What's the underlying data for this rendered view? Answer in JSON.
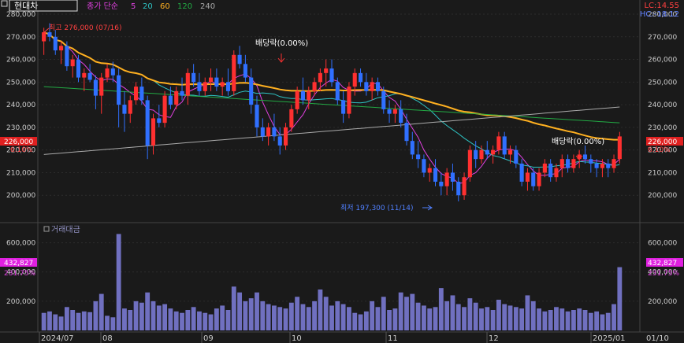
{
  "header": {
    "stock_name": "현대차",
    "ma_label": "종가 단순",
    "ma_periods": [
      "5",
      "20",
      "60",
      "120",
      "240"
    ],
    "ma_colors": [
      "#e040e0",
      "#2ec4c4",
      "#ffb020",
      "#22aa44",
      "#aaaaaa"
    ]
  },
  "top_right": {
    "lc": "LC:14.55",
    "hc": "HC:-18.12"
  },
  "annotations": {
    "high": "최고 276,000 (07/16)",
    "low": "최저 197,300 (11/14)",
    "dividend1": "배당락(0.00%)",
    "dividend2": "배당락(0.00%)"
  },
  "price_axis": {
    "ticks": [
      "280,000",
      "270,000",
      "260,000",
      "250,000",
      "240,000",
      "230,000",
      "220,000",
      "210,000",
      "200,000"
    ],
    "current_price": "226,000",
    "current_pct": "6.10%"
  },
  "volume_panel": {
    "title": "거래대금",
    "ticks": [
      "600,000",
      "400,000",
      "200,000"
    ],
    "current_value": "432,827",
    "current_pct": "231.75%"
  },
  "date_axis": {
    "labels": [
      "2024/07",
      "08",
      "09",
      "10",
      "11",
      "12",
      "2025/01",
      "01/10"
    ]
  },
  "colors": {
    "up": "#ff3030",
    "down": "#3070ff",
    "volume": "#7070c0",
    "bg": "#1a1a1a"
  },
  "chart_data": {
    "type": "candlestick",
    "price_range": [
      195000,
      283000
    ],
    "volume_range": [
      0,
      700000
    ],
    "candles": [
      [
        268000,
        274000,
        262000,
        272000,
        120000
      ],
      [
        272000,
        276000,
        268000,
        270000,
        130000
      ],
      [
        270000,
        273000,
        262000,
        264000,
        110000
      ],
      [
        264000,
        268000,
        258000,
        266000,
        95000
      ],
      [
        266000,
        268000,
        255000,
        257000,
        160000
      ],
      [
        257000,
        262000,
        252000,
        260000,
        140000
      ],
      [
        260000,
        262000,
        250000,
        252000,
        120000
      ],
      [
        252000,
        256000,
        246000,
        254000,
        130000
      ],
      [
        254000,
        258000,
        250000,
        251000,
        125000
      ],
      [
        251000,
        253000,
        238000,
        244000,
        200000
      ],
      [
        244000,
        254000,
        236000,
        252000,
        250000
      ],
      [
        252000,
        258000,
        250000,
        256000,
        100000
      ],
      [
        256000,
        259000,
        250000,
        253000,
        90000
      ],
      [
        253000,
        256000,
        230000,
        240000,
        660000
      ],
      [
        240000,
        246000,
        228000,
        236000,
        150000
      ],
      [
        236000,
        244000,
        232000,
        242000,
        140000
      ],
      [
        242000,
        250000,
        240000,
        248000,
        200000
      ],
      [
        248000,
        252000,
        240000,
        242000,
        190000
      ],
      [
        242000,
        244000,
        216000,
        222000,
        260000
      ],
      [
        222000,
        236000,
        218000,
        234000,
        200000
      ],
      [
        234000,
        240000,
        230000,
        232000,
        170000
      ],
      [
        232000,
        246000,
        230000,
        244000,
        180000
      ],
      [
        244000,
        248000,
        238000,
        240000,
        150000
      ],
      [
        240000,
        248000,
        238000,
        246000,
        130000
      ],
      [
        246000,
        252000,
        242000,
        244000,
        120000
      ],
      [
        244000,
        256000,
        240000,
        254000,
        140000
      ],
      [
        254000,
        258000,
        248000,
        250000,
        160000
      ],
      [
        250000,
        254000,
        244000,
        246000,
        130000
      ],
      [
        246000,
        252000,
        244000,
        250000,
        120000
      ],
      [
        250000,
        256000,
        246000,
        252000,
        110000
      ],
      [
        252000,
        256000,
        246000,
        248000,
        150000
      ],
      [
        248000,
        252000,
        244000,
        250000,
        170000
      ],
      [
        250000,
        256000,
        244000,
        246000,
        140000
      ],
      [
        246000,
        264000,
        244000,
        262000,
        300000
      ],
      [
        262000,
        266000,
        256000,
        258000,
        260000
      ],
      [
        258000,
        262000,
        250000,
        252000,
        200000
      ],
      [
        252000,
        256000,
        236000,
        240000,
        220000
      ],
      [
        240000,
        244000,
        226000,
        230000,
        260000
      ],
      [
        230000,
        234000,
        224000,
        226000,
        200000
      ],
      [
        226000,
        232000,
        222000,
        230000,
        180000
      ],
      [
        230000,
        236000,
        224000,
        226000,
        170000
      ],
      [
        226000,
        230000,
        218000,
        222000,
        160000
      ],
      [
        222000,
        232000,
        220000,
        230000,
        150000
      ],
      [
        230000,
        240000,
        228000,
        238000,
        190000
      ],
      [
        238000,
        248000,
        236000,
        246000,
        230000
      ],
      [
        246000,
        252000,
        240000,
        242000,
        180000
      ],
      [
        242000,
        248000,
        238000,
        246000,
        160000
      ],
      [
        246000,
        252000,
        244000,
        250000,
        200000
      ],
      [
        250000,
        256000,
        246000,
        254000,
        280000
      ],
      [
        254000,
        260000,
        248000,
        256000,
        230000
      ],
      [
        256000,
        260000,
        248000,
        250000,
        170000
      ],
      [
        250000,
        252000,
        240000,
        242000,
        200000
      ],
      [
        242000,
        246000,
        232000,
        236000,
        180000
      ],
      [
        236000,
        250000,
        234000,
        248000,
        160000
      ],
      [
        248000,
        256000,
        244000,
        254000,
        120000
      ],
      [
        254000,
        256000,
        248000,
        250000,
        110000
      ],
      [
        250000,
        254000,
        244000,
        246000,
        130000
      ],
      [
        246000,
        252000,
        242000,
        250000,
        200000
      ],
      [
        250000,
        252000,
        244000,
        246000,
        160000
      ],
      [
        246000,
        248000,
        236000,
        238000,
        230000
      ],
      [
        238000,
        242000,
        232000,
        236000,
        140000
      ],
      [
        236000,
        240000,
        232000,
        238000,
        150000
      ],
      [
        238000,
        242000,
        230000,
        232000,
        260000
      ],
      [
        232000,
        236000,
        222000,
        224000,
        230000
      ],
      [
        224000,
        228000,
        216000,
        218000,
        250000
      ],
      [
        218000,
        224000,
        212000,
        216000,
        190000
      ],
      [
        216000,
        218000,
        208000,
        210000,
        170000
      ],
      [
        210000,
        214000,
        206000,
        212000,
        150000
      ],
      [
        212000,
        216000,
        204000,
        206000,
        160000
      ],
      [
        206000,
        210000,
        200000,
        204000,
        290000
      ],
      [
        204000,
        212000,
        200000,
        210000,
        200000
      ],
      [
        210000,
        214000,
        202000,
        206000,
        240000
      ],
      [
        206000,
        208000,
        197300,
        200000,
        180000
      ],
      [
        200000,
        210000,
        198000,
        208000,
        160000
      ],
      [
        208000,
        222000,
        206000,
        220000,
        220000
      ],
      [
        220000,
        224000,
        212000,
        216000,
        190000
      ],
      [
        216000,
        222000,
        214000,
        220000,
        150000
      ],
      [
        220000,
        224000,
        216000,
        218000,
        160000
      ],
      [
        218000,
        222000,
        214000,
        220000,
        140000
      ],
      [
        220000,
        228000,
        218000,
        226000,
        210000
      ],
      [
        226000,
        228000,
        216000,
        218000,
        180000
      ],
      [
        218000,
        222000,
        214000,
        220000,
        170000
      ],
      [
        220000,
        222000,
        212000,
        214000,
        160000
      ],
      [
        214000,
        216000,
        204000,
        206000,
        150000
      ],
      [
        206000,
        212000,
        202000,
        210000,
        240000
      ],
      [
        210000,
        212000,
        202000,
        204000,
        200000
      ],
      [
        204000,
        212000,
        202000,
        210000,
        150000
      ],
      [
        210000,
        216000,
        208000,
        214000,
        130000
      ],
      [
        214000,
        216000,
        206000,
        208000,
        140000
      ],
      [
        208000,
        214000,
        206000,
        212000,
        160000
      ],
      [
        212000,
        218000,
        208000,
        216000,
        150000
      ],
      [
        216000,
        218000,
        210000,
        212000,
        130000
      ],
      [
        212000,
        218000,
        210000,
        216000,
        140000
      ],
      [
        216000,
        220000,
        212000,
        218000,
        150000
      ],
      [
        218000,
        222000,
        214000,
        216000,
        140000
      ],
      [
        216000,
        218000,
        210000,
        214000,
        120000
      ],
      [
        214000,
        216000,
        208000,
        212000,
        130000
      ],
      [
        212000,
        216000,
        208000,
        214000,
        110000
      ],
      [
        214000,
        216000,
        208000,
        212000,
        120000
      ],
      [
        212000,
        218000,
        210000,
        216000,
        180000
      ],
      [
        216000,
        228000,
        214000,
        226000,
        432827
      ]
    ]
  }
}
